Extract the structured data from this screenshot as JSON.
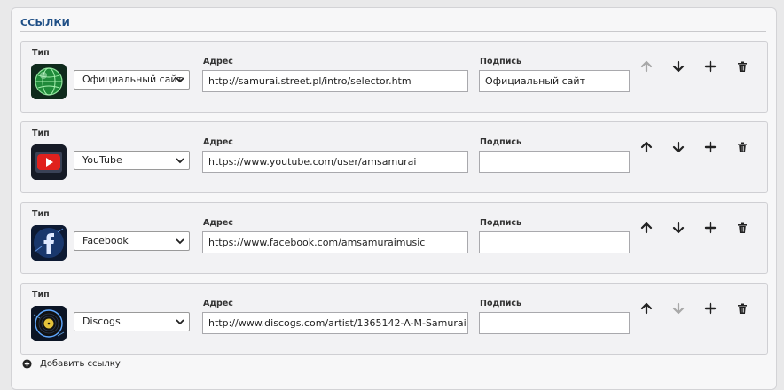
{
  "section": {
    "title": "ССЫЛКИ"
  },
  "labels": {
    "type": "Тип",
    "address": "Адрес",
    "caption": "Подпись"
  },
  "links": [
    {
      "type": "Официальный сайт",
      "icon": "globe-icon",
      "address": "http://samurai.street.pl/intro/selector.htm",
      "caption": "Официальный сайт",
      "up_enabled": false,
      "down_enabled": true
    },
    {
      "type": "YouTube",
      "icon": "youtube-icon",
      "address": "https://www.youtube.com/user/amsamurai",
      "caption": "",
      "up_enabled": true,
      "down_enabled": true
    },
    {
      "type": "Facebook",
      "icon": "facebook-icon",
      "address": "https://www.facebook.com/amsamuraimusic",
      "caption": "",
      "up_enabled": true,
      "down_enabled": true
    },
    {
      "type": "Discogs",
      "icon": "discogs-icon",
      "address": "http://www.discogs.com/artist/1365142-A-M-Samurai",
      "caption": "",
      "up_enabled": true,
      "down_enabled": false
    }
  ],
  "add_link": {
    "label": "Добавить ссылку"
  },
  "colors": {
    "title": "#1f4f86",
    "icon_enabled": "#222222",
    "icon_disabled": "#a8a8a8"
  }
}
